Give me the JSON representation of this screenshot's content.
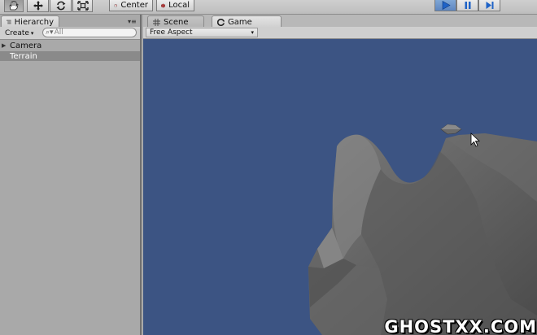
{
  "toolbar": {
    "transform_tools": [
      {
        "name": "hand-icon",
        "active": true
      },
      {
        "name": "move-icon",
        "active": false
      },
      {
        "name": "rotate-icon",
        "active": false
      },
      {
        "name": "scale-icon",
        "active": false
      }
    ],
    "pivot_label": "Center",
    "space_label": "Local",
    "play_active": true
  },
  "hierarchy": {
    "tab_label": "Hierarchy",
    "create_label": "Create",
    "search_placeholder": "All",
    "items": [
      {
        "label": "Camera",
        "expandable": true,
        "selected": false
      },
      {
        "label": "Terrain",
        "expandable": false,
        "selected": true
      }
    ]
  },
  "views": {
    "scene_tab_label": "Scene",
    "game_tab_label": "Game",
    "aspect_label": "Free Aspect",
    "background_color": "#3c5483"
  },
  "watermark": "GHOSTXX.COM"
}
